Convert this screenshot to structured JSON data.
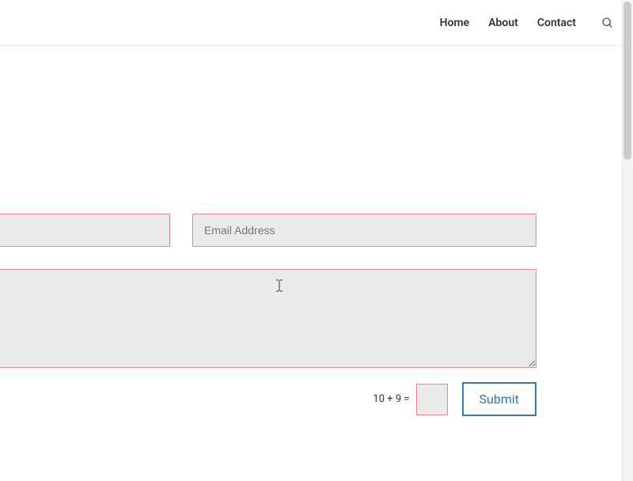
{
  "nav": {
    "home": "Home",
    "about": "About",
    "contact": "Contact"
  },
  "form": {
    "name_value": "",
    "email_placeholder": "Email Address",
    "email_value": "",
    "message_value": "",
    "captcha_question": "10 + 9 =",
    "captcha_value": "",
    "submit_label": "Submit"
  },
  "colors": {
    "input_bg": "#eaeaea",
    "input_border": "#e88",
    "submit_border": "#2e7bb8",
    "submit_text": "#2e7bb8"
  }
}
